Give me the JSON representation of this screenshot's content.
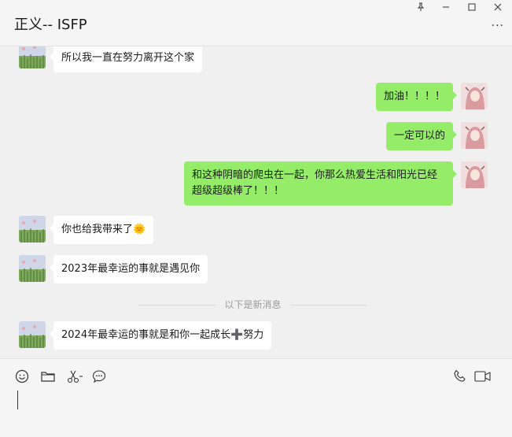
{
  "window": {
    "title": "正义-- ISFP",
    "pin_icon": "pin-icon",
    "minimize_icon": "minimize-icon",
    "maximize_icon": "maximize-icon",
    "close_icon": "close-icon",
    "more_icon": "more-icon"
  },
  "messages": [
    {
      "side": "in",
      "text": "所以我一直在努力离开这个家"
    },
    {
      "side": "out",
      "text": "加油！！！！"
    },
    {
      "side": "out",
      "text": "一定可以的"
    },
    {
      "side": "out",
      "text": "和这种阴暗的爬虫在一起，你那么热爱生活和阳光已经超级超级棒了！！！"
    },
    {
      "side": "in",
      "text": "你也给我带来了🌞"
    },
    {
      "side": "in",
      "text": "2023年最幸运的事就是遇见你"
    },
    {
      "side": "in",
      "text": "2024年最幸运的事就是和你一起成长➕努力"
    }
  ],
  "divider_text": "以下是新消息",
  "toolbar": {
    "icons": [
      "emoji-icon",
      "folder-icon",
      "scissors-icon",
      "chat-bubble-icon",
      "phone-icon",
      "video-icon"
    ]
  },
  "colors": {
    "outgoing_bubble": "#95ec69",
    "incoming_bubble": "#ffffff",
    "chat_background": "#f0f0f0"
  }
}
